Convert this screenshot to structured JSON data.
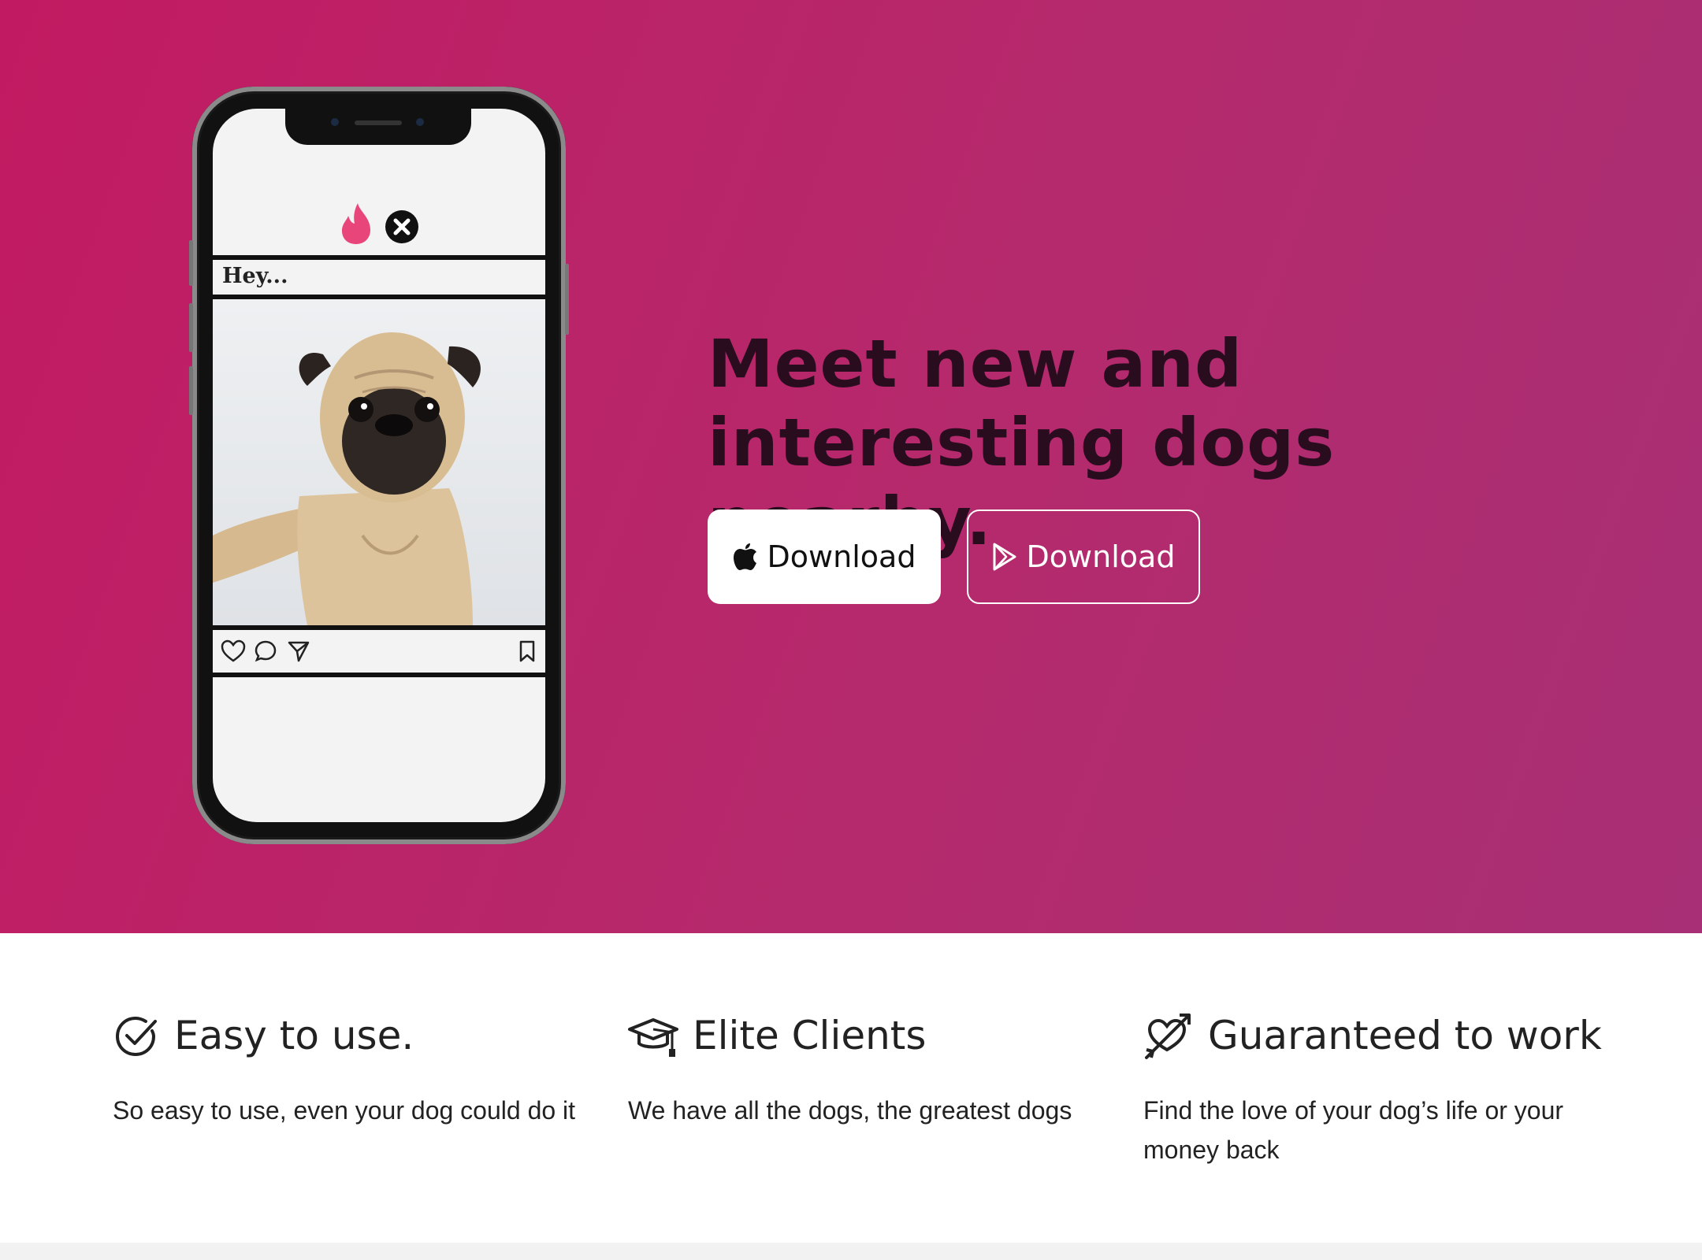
{
  "hero": {
    "headline": "Meet new and interesting dogs nearby.",
    "phone": {
      "caption": "Hey...",
      "icons": [
        "flame-icon",
        "close-icon",
        "heart-icon",
        "comment-icon",
        "send-icon",
        "bookmark-icon"
      ]
    },
    "buttons": {
      "apple_label": "Download",
      "play_label": "Download"
    }
  },
  "features": [
    {
      "icon": "check-circle-icon",
      "title": "Easy to use.",
      "text": "So easy to use, even your dog could do it"
    },
    {
      "icon": "graduation-cap-icon",
      "title": "Elite Clients",
      "text": "We have all the dogs, the greatest dogs"
    },
    {
      "icon": "heart-arrow-icon",
      "title": "Guaranteed to work",
      "text": "Find the love of your dog’s life or your money back"
    }
  ],
  "colors": {
    "hero_gradient_start": "#c21a62",
    "hero_gradient_end": "#a82f75",
    "headline": "#2a0c1f",
    "accent_flame": "#e8457a"
  }
}
